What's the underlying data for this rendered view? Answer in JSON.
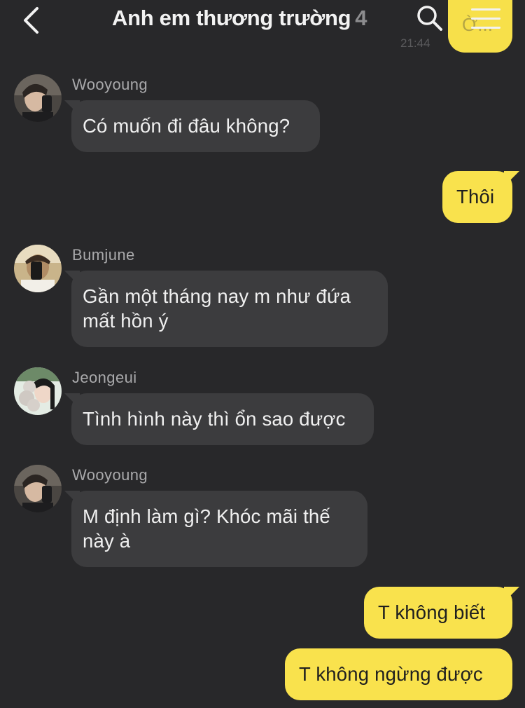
{
  "header": {
    "back_icon": "chevron-left-icon",
    "title": "Anh em thương trường",
    "member_count": "4",
    "search_icon": "search-icon",
    "menu_icon": "menu-icon",
    "partial_message_text": "Ờ...",
    "partial_message_time": "21:44"
  },
  "colors": {
    "background": "#28282a",
    "incoming_bubble": "#3c3c3e",
    "outgoing_bubble": "#f9e24d",
    "sender_name": "#a9a9ab"
  },
  "messages": [
    {
      "direction": "in",
      "sender": "Wooyoung",
      "avatar": "avatar-wooyoung",
      "text": "Có muốn đi đâu không?"
    },
    {
      "direction": "out",
      "text": "Thôi"
    },
    {
      "direction": "in",
      "sender": "Bumjune",
      "avatar": "avatar-bumjune",
      "text": "Gần một tháng nay m như đứa mất hồn ý"
    },
    {
      "direction": "in",
      "sender": "Jeongeui",
      "avatar": "avatar-jeongeui",
      "text": "Tình hình này thì ổn sao được"
    },
    {
      "direction": "in",
      "sender": "Wooyoung",
      "avatar": "avatar-wooyoung",
      "text": "M định làm gì? Khóc mãi thế này à"
    },
    {
      "direction": "out",
      "text": "T không biết"
    },
    {
      "direction": "out",
      "text": "T không ngừng được"
    }
  ]
}
